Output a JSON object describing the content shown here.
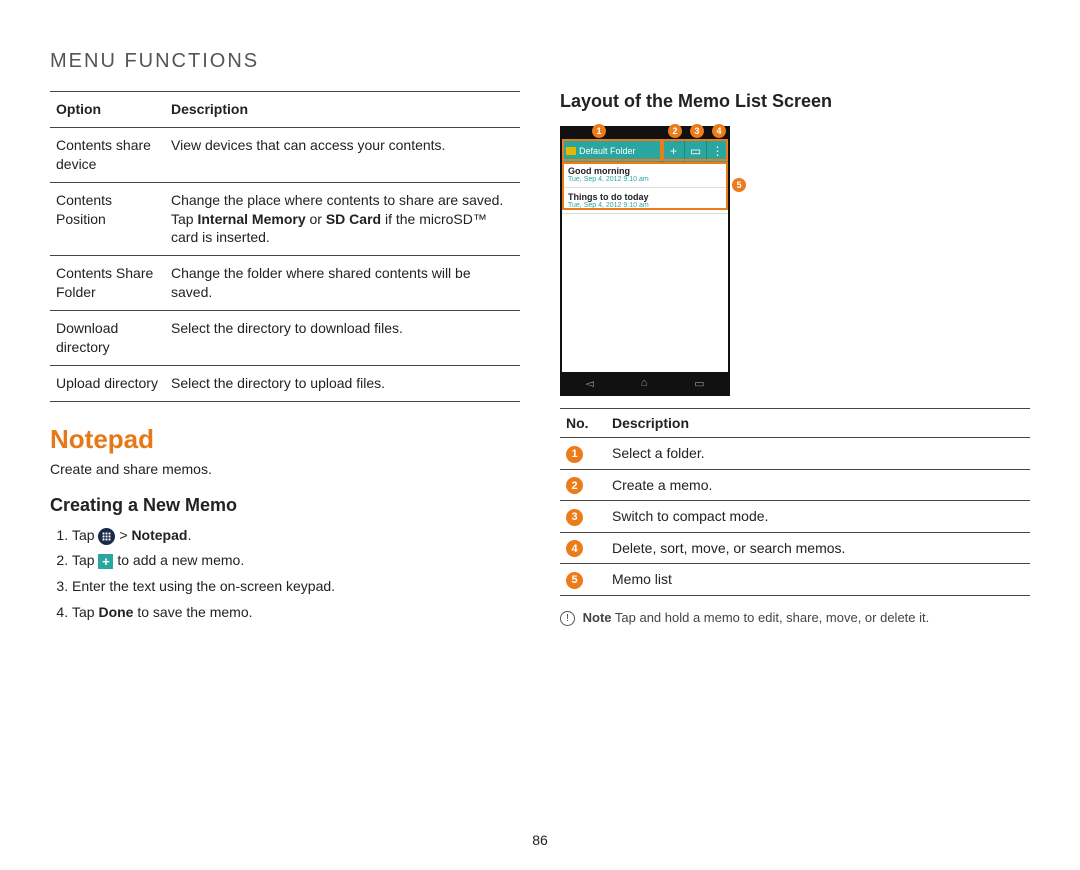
{
  "page_title": "MENU FUNCTIONS",
  "page_number": "86",
  "options_table": {
    "headers": [
      "Option",
      "Description"
    ],
    "rows": [
      {
        "option": "Contents share device",
        "desc_plain": "View devices that can access your contents."
      },
      {
        "option": "Contents Position",
        "desc_pre": "Change the place where contents to share are saved. Tap ",
        "desc_b1": "Internal Memory",
        "desc_mid": " or ",
        "desc_b2": "SD Card",
        "desc_post": " if the microSD™ card is inserted."
      },
      {
        "option": "Contents Share Folder",
        "desc_plain": "Change the folder where shared contents will be saved."
      },
      {
        "option": "Download directory",
        "desc_plain": "Select the directory to download files."
      },
      {
        "option": "Upload directory",
        "desc_plain": "Select the directory to upload files."
      }
    ]
  },
  "notepad": {
    "title": "Notepad",
    "subtitle": "Create and share memos.",
    "creating_title": "Creating a New Memo",
    "steps": {
      "s1_pre": "Tap ",
      "s1_sep": " > ",
      "s1_bold": "Notepad",
      "s1_post": ".",
      "s2_pre": "Tap ",
      "s2_post": " to add a new memo.",
      "s3": "Enter the text using the on-screen keypad.",
      "s4_pre": "Tap ",
      "s4_bold": "Done",
      "s4_post": " to save the memo."
    }
  },
  "layout_title": "Layout of the Memo List Screen",
  "phone": {
    "folder_label": "Default Folder",
    "toolbar_icons": {
      "add": "+",
      "compact": "▭",
      "menu": "⋮"
    },
    "memos": [
      {
        "title": "Good morning",
        "date": "Tue, Sep 4, 2012 9:10 am"
      },
      {
        "title": "Things to do today",
        "date": "Tue, Sep 4, 2012 9:10 am"
      }
    ],
    "nav": {
      "back": "◅",
      "home": "⌂",
      "recent": "▭"
    },
    "callouts": [
      "1",
      "2",
      "3",
      "4",
      "5"
    ]
  },
  "num_table": {
    "headers": [
      "No.",
      "Description"
    ],
    "rows": [
      {
        "n": "1",
        "d": "Select a folder."
      },
      {
        "n": "2",
        "d": "Create a memo."
      },
      {
        "n": "3",
        "d": "Switch to compact mode."
      },
      {
        "n": "4",
        "d": "Delete, sort, move, or search memos."
      },
      {
        "n": "5",
        "d": "Memo list"
      }
    ]
  },
  "note": {
    "icon": "!",
    "label": "Note",
    "text": " Tap and hold a memo to edit, share, move, or delete it."
  }
}
